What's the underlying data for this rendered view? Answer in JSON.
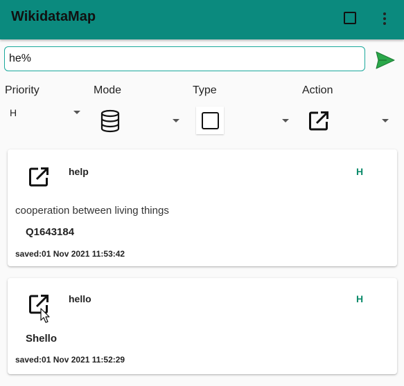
{
  "app": {
    "title": "WikidataMap"
  },
  "search": {
    "value": "he%"
  },
  "filters": {
    "priority_label": "Priority",
    "mode_label": "Mode",
    "type_label": "Type",
    "action_label": "Action",
    "priority_value": "H"
  },
  "results": [
    {
      "title": "help",
      "priority": "H",
      "description": "cooperation between living things",
      "qid": "Q1643184",
      "saved": "saved:01 Nov 2021 11:53:42"
    },
    {
      "title": "hello",
      "priority": "H",
      "label": "Shello",
      "saved": "saved:01 Nov 2021 11:52:29"
    }
  ],
  "colors": {
    "appbar": "#0b8a7e",
    "accent": "#1aa89b",
    "send": "#2aa84a",
    "priority_text": "#0b8a6a"
  },
  "icons": {
    "appbar_square": "square-outline-icon",
    "overflow": "more-vert-icon",
    "send": "send-icon",
    "mode": "database-icon",
    "type": "square-outline-icon",
    "action": "open-in-new-icon"
  }
}
